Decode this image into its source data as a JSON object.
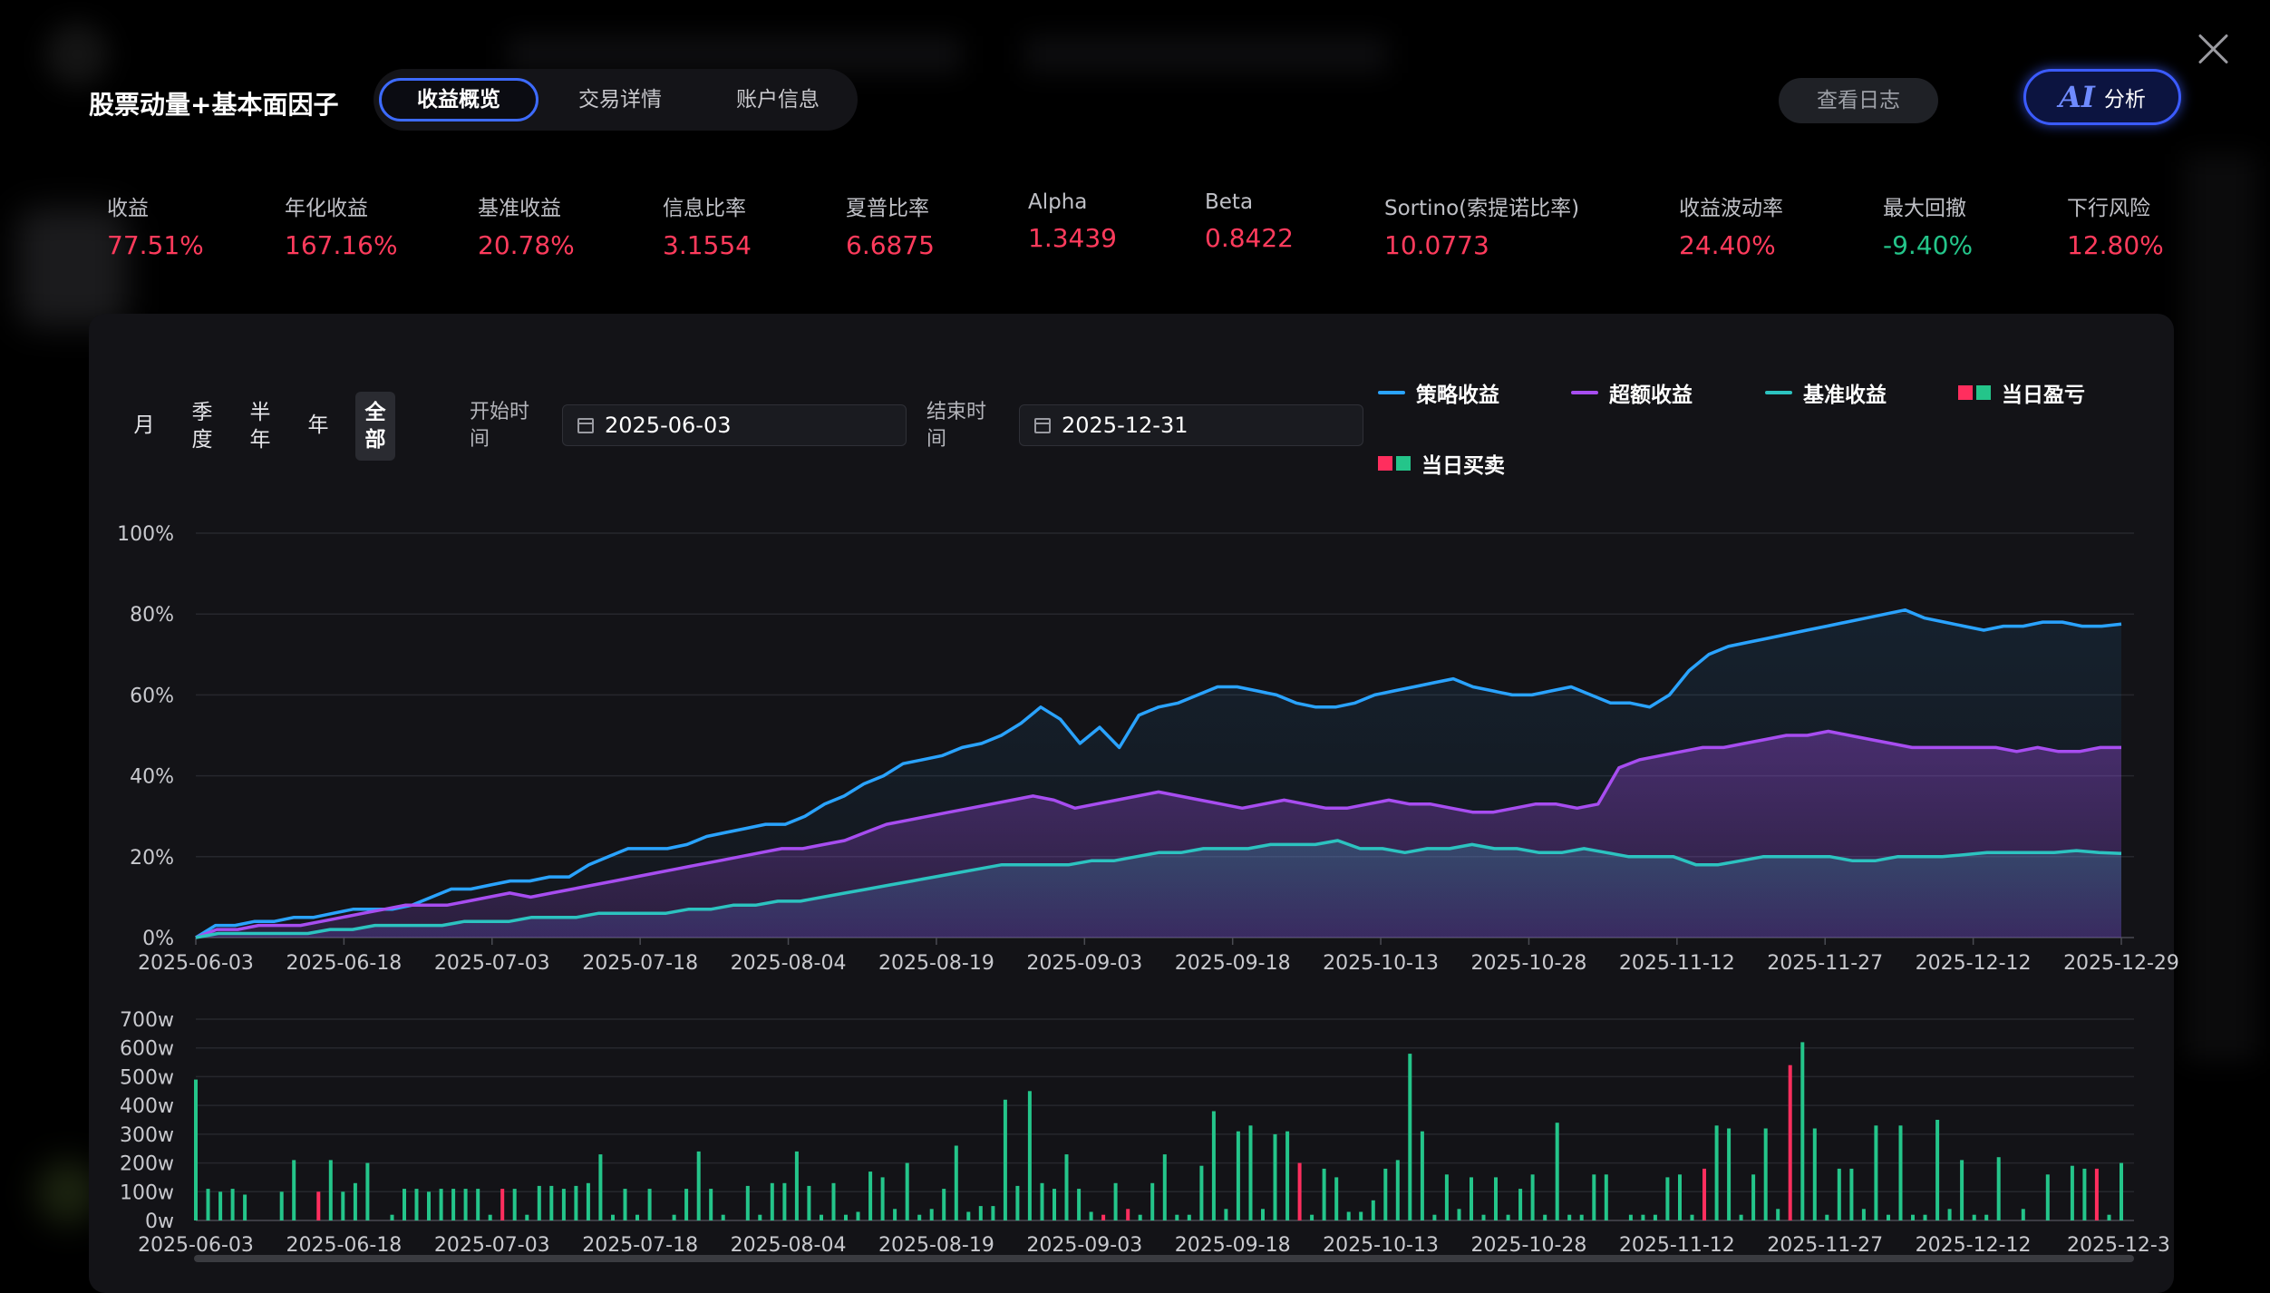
{
  "header": {
    "title": "股票动量+基本面因子",
    "tabs": [
      {
        "label": "收益概览",
        "active": true
      },
      {
        "label": "交易详情",
        "active": false
      },
      {
        "label": "账户信息",
        "active": false
      }
    ],
    "log_button": "查看日志",
    "ai_button": {
      "mark": "AI",
      "label": "分析"
    }
  },
  "metrics": [
    {
      "label": "收益",
      "value": "77.51%",
      "color": "#ff3b5c"
    },
    {
      "label": "年化收益",
      "value": "167.16%",
      "color": "#ff3b5c"
    },
    {
      "label": "基准收益",
      "value": "20.78%",
      "color": "#ff3b5c"
    },
    {
      "label": "信息比率",
      "value": "3.1554",
      "color": "#ff3b5c"
    },
    {
      "label": "夏普比率",
      "value": "6.6875",
      "color": "#ff3b5c"
    },
    {
      "label": "Alpha",
      "value": "1.3439",
      "color": "#ff3b5c"
    },
    {
      "label": "Beta",
      "value": "0.8422",
      "color": "#ff3b5c"
    },
    {
      "label": "Sortino(索提诺比率)",
      "value": "10.0773",
      "color": "#ff3b5c"
    },
    {
      "label": "收益波动率",
      "value": "24.40%",
      "color": "#ff3b5c"
    },
    {
      "label": "最大回撤",
      "value": "-9.40%",
      "color": "#24c58a"
    },
    {
      "label": "下行风险",
      "value": "12.80%",
      "color": "#ff3b5c"
    }
  ],
  "controls": {
    "periods": [
      {
        "l1": "月",
        "l2": ""
      },
      {
        "l1": "季",
        "l2": "度"
      },
      {
        "l1": "半",
        "l2": "年"
      },
      {
        "l1": "年",
        "l2": ""
      },
      {
        "l1": "全",
        "l2": "部"
      }
    ],
    "active_period": "全部",
    "start_label": [
      "开始时",
      "间"
    ],
    "start_date": "2025-06-03",
    "end_label": [
      "结束时",
      "间"
    ],
    "end_date": "2025-12-31"
  },
  "legend": [
    {
      "label": "策略收益",
      "type": "line",
      "color": "#2aa3ff"
    },
    {
      "label": "超额收益",
      "type": "line",
      "color": "#a74df0"
    },
    {
      "label": "基准收益",
      "type": "line",
      "color": "#2cc3c0"
    },
    {
      "label": "当日盈亏",
      "type": "squares",
      "colors": [
        "#ff2e5e",
        "#24c58a"
      ]
    },
    {
      "label": "当日买卖",
      "type": "squares",
      "colors": [
        "#ff2e5e",
        "#24c58a"
      ]
    }
  ],
  "chart_data": [
    {
      "type": "line",
      "x_ticks": [
        "2025-06-03",
        "2025-06-18",
        "2025-07-03",
        "2025-07-18",
        "2025-08-04",
        "2025-08-19",
        "2025-09-03",
        "2025-09-18",
        "2025-10-13",
        "2025-10-28",
        "2025-11-12",
        "2025-11-27",
        "2025-12-12",
        "2025-12-29"
      ],
      "y_ticks": [
        "0%",
        "20%",
        "40%",
        "60%",
        "80%",
        "100%"
      ],
      "ylim": [
        0,
        100
      ],
      "grid": true,
      "legend_position": "top-right",
      "series": [
        {
          "name": "策略收益",
          "color": "#2aa3ff",
          "values": [
            0,
            3,
            3,
            4,
            4,
            5,
            5,
            6,
            7,
            7,
            7,
            8,
            10,
            12,
            12,
            13,
            14,
            14,
            15,
            15,
            18,
            20,
            22,
            22,
            22,
            23,
            25,
            26,
            27,
            28,
            28,
            30,
            33,
            35,
            38,
            40,
            43,
            44,
            45,
            47,
            48,
            50,
            53,
            57,
            54,
            48,
            52,
            47,
            55,
            57,
            58,
            60,
            62,
            62,
            61,
            60,
            58,
            57,
            57,
            58,
            60,
            61,
            62,
            63,
            64,
            62,
            61,
            60,
            60,
            61,
            62,
            60,
            58,
            58,
            57,
            60,
            66,
            70,
            72,
            73,
            74,
            75,
            76,
            77,
            78,
            79,
            80,
            81,
            79,
            78,
            77,
            76,
            77,
            77,
            78,
            78,
            77,
            77,
            77.5
          ]
        },
        {
          "name": "超额收益",
          "color": "#a74df0",
          "values": [
            0,
            2,
            2,
            3,
            3,
            3,
            4,
            5,
            6,
            7,
            8,
            8,
            8,
            9,
            10,
            11,
            10,
            11,
            12,
            13,
            14,
            15,
            16,
            17,
            18,
            19,
            20,
            21,
            22,
            22,
            23,
            24,
            26,
            28,
            29,
            30,
            31,
            32,
            33,
            34,
            35,
            34,
            32,
            33,
            34,
            35,
            36,
            35,
            34,
            33,
            32,
            33,
            34,
            33,
            32,
            32,
            33,
            34,
            33,
            33,
            32,
            31,
            31,
            32,
            33,
            33,
            32,
            33,
            42,
            44,
            45,
            46,
            47,
            47,
            48,
            49,
            50,
            50,
            51,
            50,
            49,
            48,
            47,
            47,
            47,
            47,
            47,
            46,
            47,
            46,
            46,
            47,
            47
          ]
        },
        {
          "name": "基准收益",
          "color": "#2cc3c0",
          "values": [
            0,
            1,
            1,
            1,
            1,
            1,
            2,
            2,
            3,
            3,
            3,
            3,
            4,
            4,
            4,
            5,
            5,
            5,
            6,
            6,
            6,
            6,
            7,
            7,
            8,
            8,
            9,
            9,
            10,
            11,
            12,
            13,
            14,
            15,
            16,
            17,
            18,
            18,
            18,
            18,
            19,
            19,
            20,
            21,
            21,
            22,
            22,
            22,
            23,
            23,
            23,
            24,
            22,
            22,
            21,
            22,
            22,
            23,
            22,
            22,
            21,
            21,
            22,
            21,
            20,
            20,
            20,
            18,
            18,
            19,
            20,
            20,
            20,
            20,
            19,
            19,
            20,
            20,
            20,
            20.5,
            21,
            21,
            21,
            21,
            21.5,
            21,
            20.78
          ]
        }
      ]
    },
    {
      "type": "bar",
      "x_ticks": [
        "2025-06-03",
        "2025-06-18",
        "2025-07-03",
        "2025-07-18",
        "2025-08-04",
        "2025-08-19",
        "2025-09-03",
        "2025-09-18",
        "2025-10-13",
        "2025-10-28",
        "2025-11-12",
        "2025-11-27",
        "2025-12-12",
        "2025-12-3"
      ],
      "y_ticks": [
        "0w",
        "100w",
        "200w",
        "300w",
        "400w",
        "500w",
        "600w",
        "700w"
      ],
      "ylim": [
        0,
        700
      ],
      "series": [
        {
          "name": "当日买卖",
          "colors": [
            "#ff2e5e",
            "#24c58a"
          ],
          "values": [
            490,
            110,
            100,
            110,
            90,
            0,
            0,
            100,
            210,
            0,
            100,
            210,
            100,
            130,
            200,
            0,
            20,
            110,
            110,
            100,
            110,
            110,
            110,
            110,
            20,
            110,
            110,
            20,
            120,
            120,
            110,
            120,
            130,
            230,
            20,
            110,
            20,
            110,
            0,
            20,
            110,
            240,
            110,
            20,
            0,
            120,
            20,
            130,
            130,
            240,
            120,
            20,
            130,
            20,
            30,
            170,
            150,
            40,
            200,
            20,
            40,
            110,
            260,
            30,
            50,
            50,
            420,
            120,
            450,
            130,
            110,
            230,
            110,
            30,
            20,
            130,
            40,
            20,
            130,
            230,
            20,
            20,
            190,
            380,
            40,
            310,
            330,
            40,
            300,
            310,
            200,
            20,
            180,
            150,
            30,
            30,
            70,
            180,
            210,
            580,
            310,
            20,
            160,
            40,
            150,
            20,
            150,
            20,
            110,
            160,
            20,
            340,
            20,
            20,
            160,
            160,
            0,
            20,
            20,
            20,
            150,
            160,
            20,
            180,
            330,
            320,
            20,
            160,
            320,
            40,
            540,
            620,
            320,
            20,
            180,
            180,
            40,
            330,
            20,
            330,
            20,
            20,
            350,
            40,
            210,
            20,
            20,
            220,
            0,
            40,
            0,
            160,
            0,
            190,
            180,
            180,
            20,
            200
          ],
          "negative_indices": [
            10,
            25,
            74,
            76,
            90,
            116,
            123,
            130,
            155
          ]
        }
      ]
    }
  ]
}
